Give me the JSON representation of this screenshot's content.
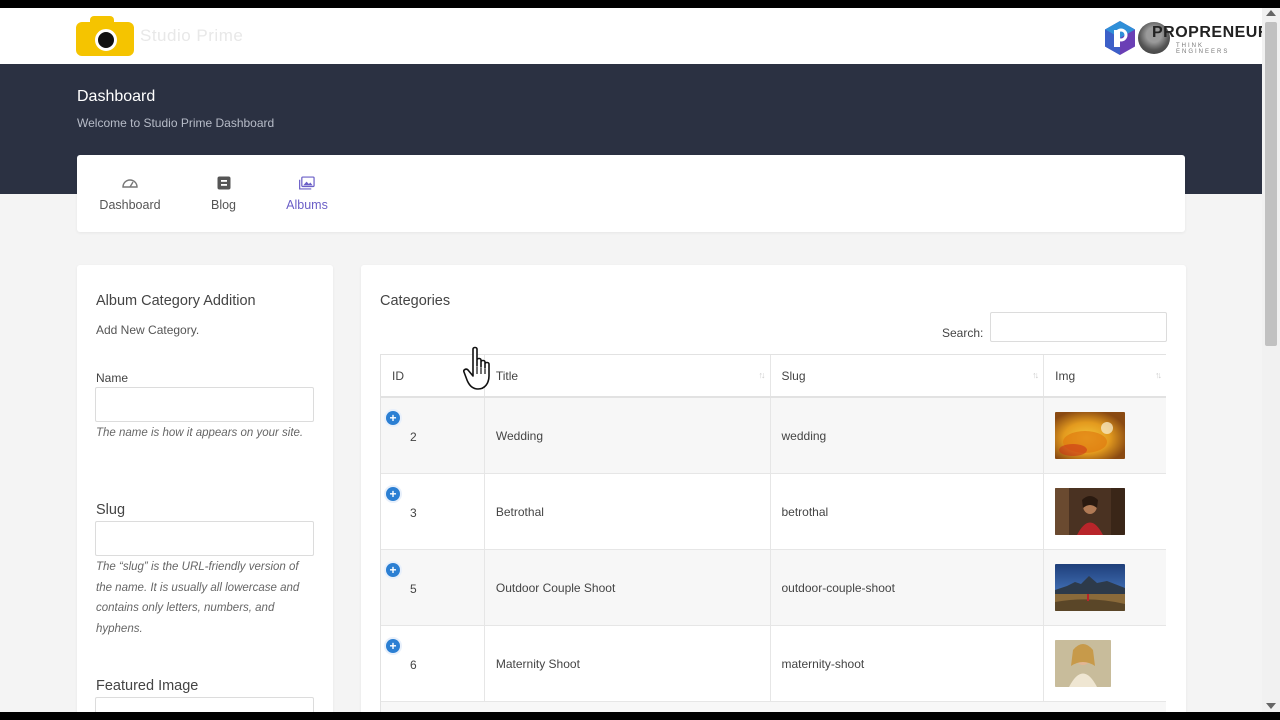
{
  "header": {
    "logo_text": "Studio Prime",
    "brand_text": "PROPRENEUR",
    "brand_sub": "THINK ENGINEERS",
    "logo_color": "#f5c400"
  },
  "hero": {
    "title": "Dashboard",
    "subtitle": "Welcome to Studio Prime Dashboard",
    "bg_color": "#2b3142"
  },
  "nav": {
    "items": [
      {
        "label": "Dashboard",
        "icon": "dashboard-icon"
      },
      {
        "label": "Blog",
        "icon": "blog-icon"
      },
      {
        "label": "Albums",
        "icon": "albums-icon",
        "active": true
      }
    ],
    "active_color": "#6b5fc7"
  },
  "form": {
    "title": "Album Category Addition",
    "subtitle": "Add New Category.",
    "name_label": "Name",
    "name_value": "",
    "name_help": "The name is how it appears on your site.",
    "slug_label": "Slug",
    "slug_value": "",
    "slug_help": "The “slug” is the URL-friendly version of the name. It is usually all lowercase and contains only letters, numbers, and hyphens.",
    "image_label": "Featured Image"
  },
  "categories": {
    "title": "Categories",
    "search_label": "Search:",
    "search_value": "",
    "columns": [
      "ID",
      "Title",
      "Slug",
      "Img"
    ],
    "rows": [
      {
        "id": "2",
        "title": "Wedding",
        "slug": "wedding",
        "img": "wedding-thumbnail"
      },
      {
        "id": "3",
        "title": "Betrothal",
        "slug": "betrothal",
        "img": "betrothal-thumbnail"
      },
      {
        "id": "5",
        "title": "Outdoor Couple Shoot",
        "slug": "outdoor-couple-shoot",
        "img": "outdoor-couple-shoot-thumbnail"
      },
      {
        "id": "6",
        "title": "Maternity Shoot",
        "slug": "maternity-shoot",
        "img": "maternity-shoot-thumbnail"
      }
    ],
    "expand_color": "#2b7fd3"
  }
}
